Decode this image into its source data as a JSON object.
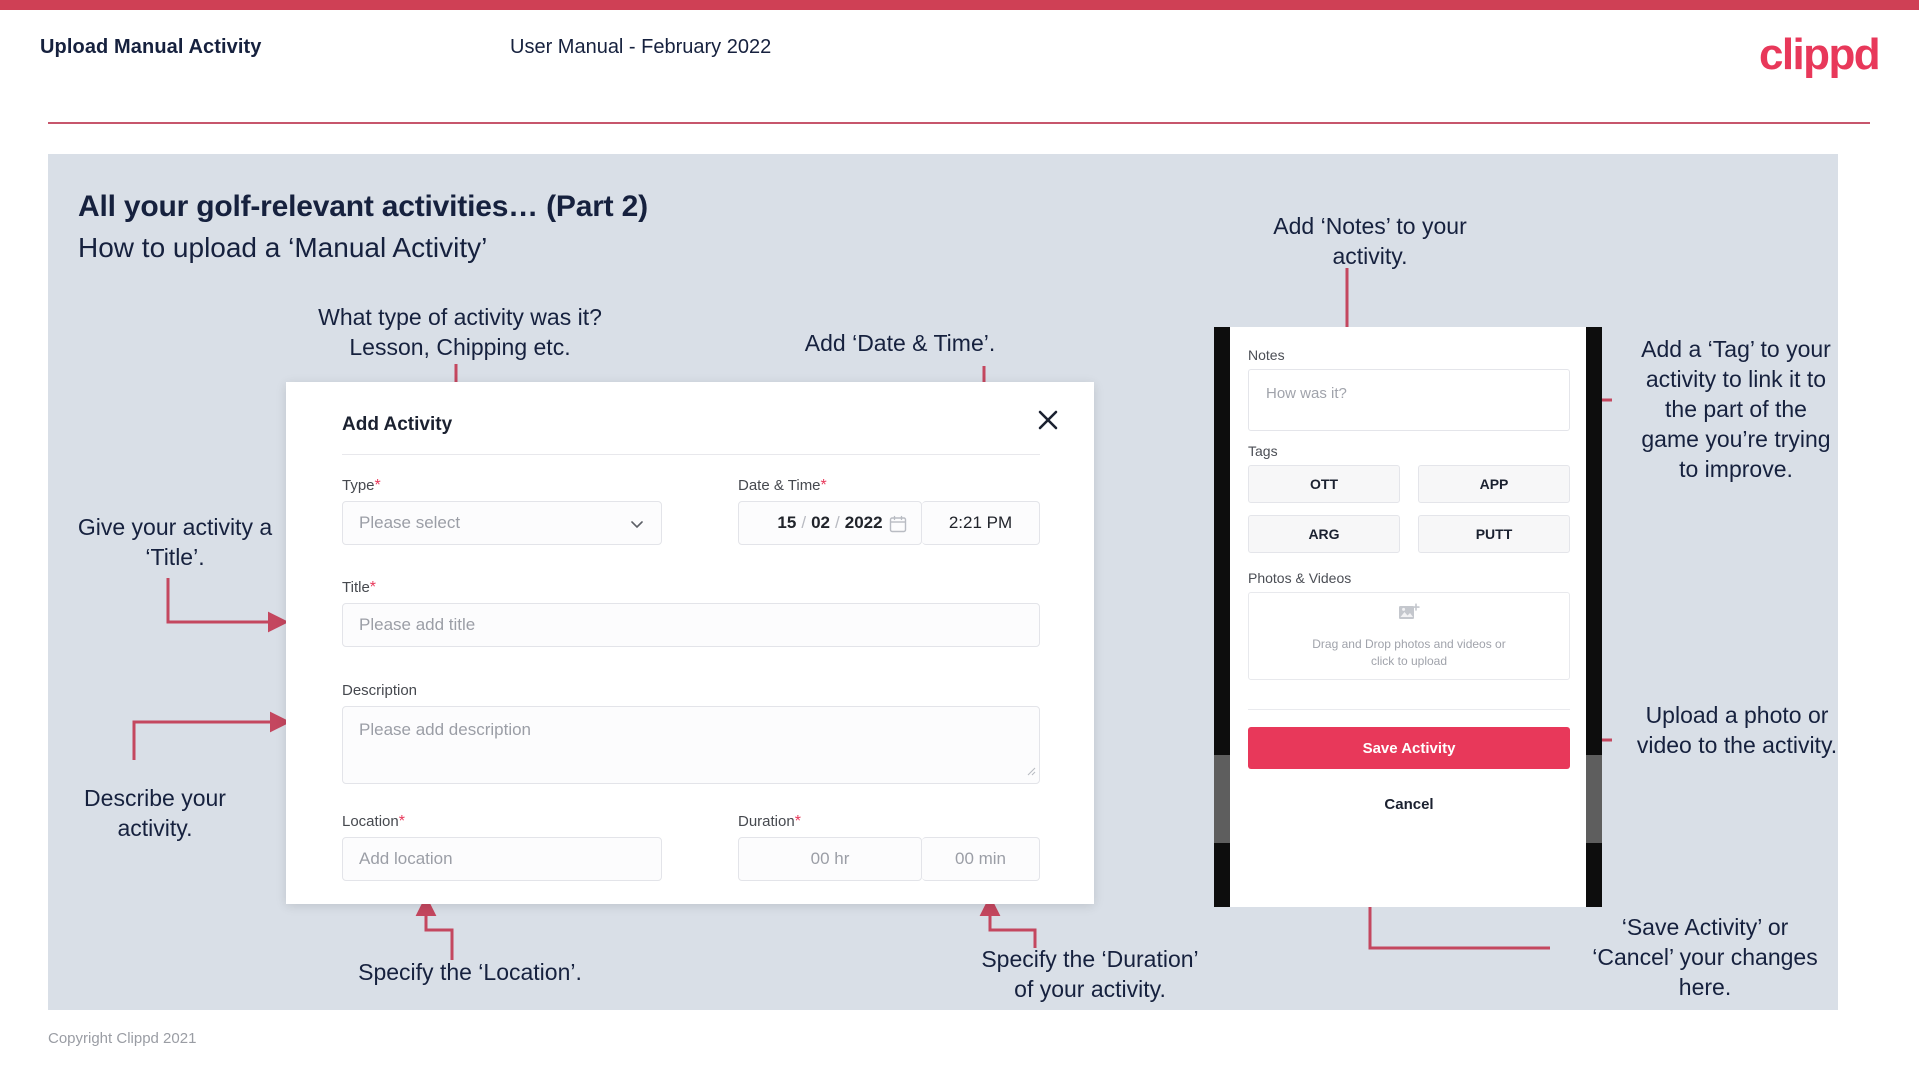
{
  "header": {
    "left_title": "Upload Manual Activity",
    "center_title": "User Manual - February 2022",
    "logo": "clippd"
  },
  "slide": {
    "title": "All your golf-relevant activities… (Part 2)",
    "subtitle": "How to upload a ‘Manual Activity’"
  },
  "annotations": {
    "type": "What type of activity was it?\nLesson, Chipping etc.",
    "datetime": "Add ‘Date & Time’.",
    "notes": "Add ‘Notes’ to your\nactivity.",
    "tag": "Add a ‘Tag’ to your\nactivity to link it to\nthe part of the\ngame you’re trying\nto improve.",
    "title_field": "Give your activity a\n‘Title’.",
    "description": "Describe your\nactivity.",
    "location": "Specify the ‘Location’.",
    "duration": "Specify the ‘Duration’\nof your activity.",
    "upload": "Upload a photo or\nvideo to the activity.",
    "save_cancel": "‘Save Activity’ or\n‘Cancel’ your changes\nhere."
  },
  "dialog": {
    "title": "Add Activity",
    "close_icon": "close-icon",
    "fields": {
      "type": {
        "label": "Type",
        "required": "*",
        "placeholder": "Please select",
        "icon": "chevron-down-icon"
      },
      "datetime": {
        "label": "Date & Time",
        "required": "*",
        "day": "15",
        "month": "02",
        "year": "2022",
        "sep": "/",
        "icon": "calendar-icon",
        "time": "2:21 PM"
      },
      "title": {
        "label": "Title",
        "required": "*",
        "placeholder": "Please add title"
      },
      "description": {
        "label": "Description",
        "required": "",
        "placeholder": "Please add description"
      },
      "location": {
        "label": "Location",
        "required": "*",
        "placeholder": "Add location"
      },
      "duration": {
        "label": "Duration",
        "required": "*",
        "hours": "00 hr",
        "minutes": "00 min"
      }
    }
  },
  "phone": {
    "notes_label": "Notes",
    "notes_placeholder": "How was it?",
    "tags_label": "Tags",
    "tags": [
      "OTT",
      "APP",
      "ARG",
      "PUTT"
    ],
    "photos_label": "Photos & Videos",
    "dropzone_icon": "add-image-icon",
    "dropzone_text_1": "Drag and Drop photos and videos or",
    "dropzone_text_2": "click to upload",
    "save_label": "Save Activity",
    "cancel_label": "Cancel"
  },
  "footer": {
    "copyright": "Copyright Clippd 2021"
  },
  "colors": {
    "brand_pink": "#e8385a",
    "top_bar": "#cf4055",
    "slide_bg": "#d9dfe7",
    "ink": "#16213e",
    "connector": "#c4475f"
  }
}
